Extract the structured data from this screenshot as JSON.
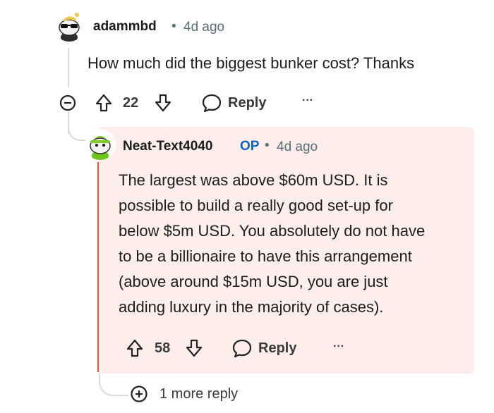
{
  "comment": {
    "username": "adammbd",
    "separator": "•",
    "time": "4d ago",
    "body": "How much did the biggest bunker cost? Thanks",
    "votes": "22",
    "reply_label": "Reply",
    "more": "···"
  },
  "reply": {
    "username": "Neat-Text4040",
    "op_tag": "OP",
    "separator": "•",
    "time": "4d ago",
    "lines": [
      "The largest was above $60m USD. It is",
      "possible to build a really good set-up for",
      "below $5m USD. You absolutely do not have",
      "to be a billionaire to have this arrangement",
      "(above around $15m USD, you are just",
      "adding luxury in the majority of cases)."
    ],
    "votes": "58",
    "reply_label": "Reply",
    "more": "···"
  },
  "more_replies": "1 more reply",
  "colors": {
    "reply_bg": "#fdeeec",
    "op_blue": "#0a66c8",
    "meta_gray": "#576f76",
    "thread_line": "#d8dadc",
    "accent_red": "#e05a3a"
  },
  "icons": [
    "collapse-icon",
    "upvote-icon",
    "downvote-icon",
    "comment-bubble-icon",
    "expand-plus-icon"
  ]
}
